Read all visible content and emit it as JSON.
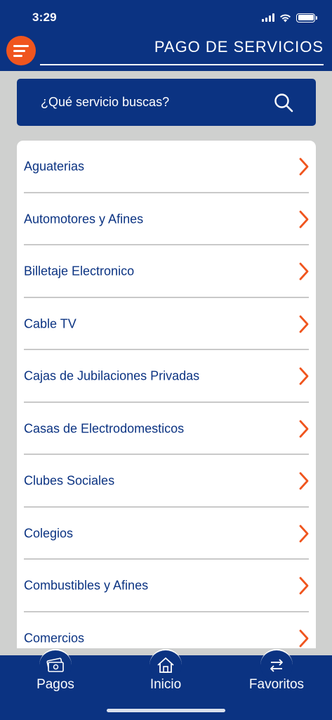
{
  "status_bar": {
    "time": "3:29"
  },
  "header": {
    "title": "PAGO DE SERVICIOS",
    "menu_icon": "menu-icon"
  },
  "search": {
    "placeholder": "¿Qué servicio buscas?",
    "icon": "search-icon"
  },
  "services": [
    {
      "label": "Aguaterias"
    },
    {
      "label": "Automotores y Afines"
    },
    {
      "label": "Billetaje Electronico"
    },
    {
      "label": "Cable TV"
    },
    {
      "label": "Cajas de Jubilaciones Privadas"
    },
    {
      "label": "Casas de Electrodomesticos"
    },
    {
      "label": "Clubes Sociales"
    },
    {
      "label": "Colegios"
    },
    {
      "label": "Combustibles y Afines"
    },
    {
      "label": "Comercios"
    }
  ],
  "tabbar": {
    "tabs": [
      {
        "label": "Pagos",
        "icon": "money-icon"
      },
      {
        "label": "Inicio",
        "icon": "home-icon"
      },
      {
        "label": "Favoritos",
        "icon": "transfer-arrows-icon"
      }
    ]
  },
  "colors": {
    "primary": "#0b3382",
    "accent": "#f0551e",
    "background": "#cfd0cf",
    "divider": "#c9c9c9"
  }
}
